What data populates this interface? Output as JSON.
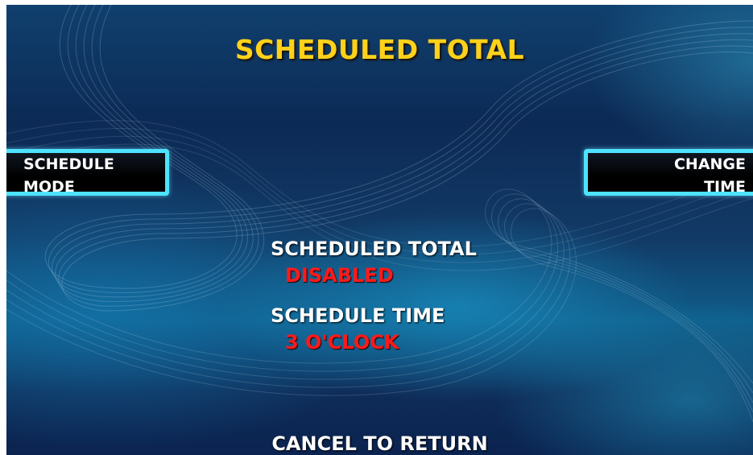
{
  "screen": {
    "title": "SCHEDULED TOTAL",
    "footer": "CANCEL TO RETURN",
    "colors": {
      "title": "#ffd11a",
      "value": "#ff1a1a",
      "button_border": "#4de3ff",
      "background": "#0c2a55"
    }
  },
  "softkeys": {
    "left": {
      "line1": "SCHEDULE",
      "line2": "MODE"
    },
    "right": {
      "line1": "CHANGE",
      "line2": "TIME"
    }
  },
  "settings": {
    "scheduled_total": {
      "label": "SCHEDULED TOTAL",
      "value": "DISABLED"
    },
    "schedule_time": {
      "label": "SCHEDULE TIME",
      "value": "3 O'CLOCK"
    }
  }
}
